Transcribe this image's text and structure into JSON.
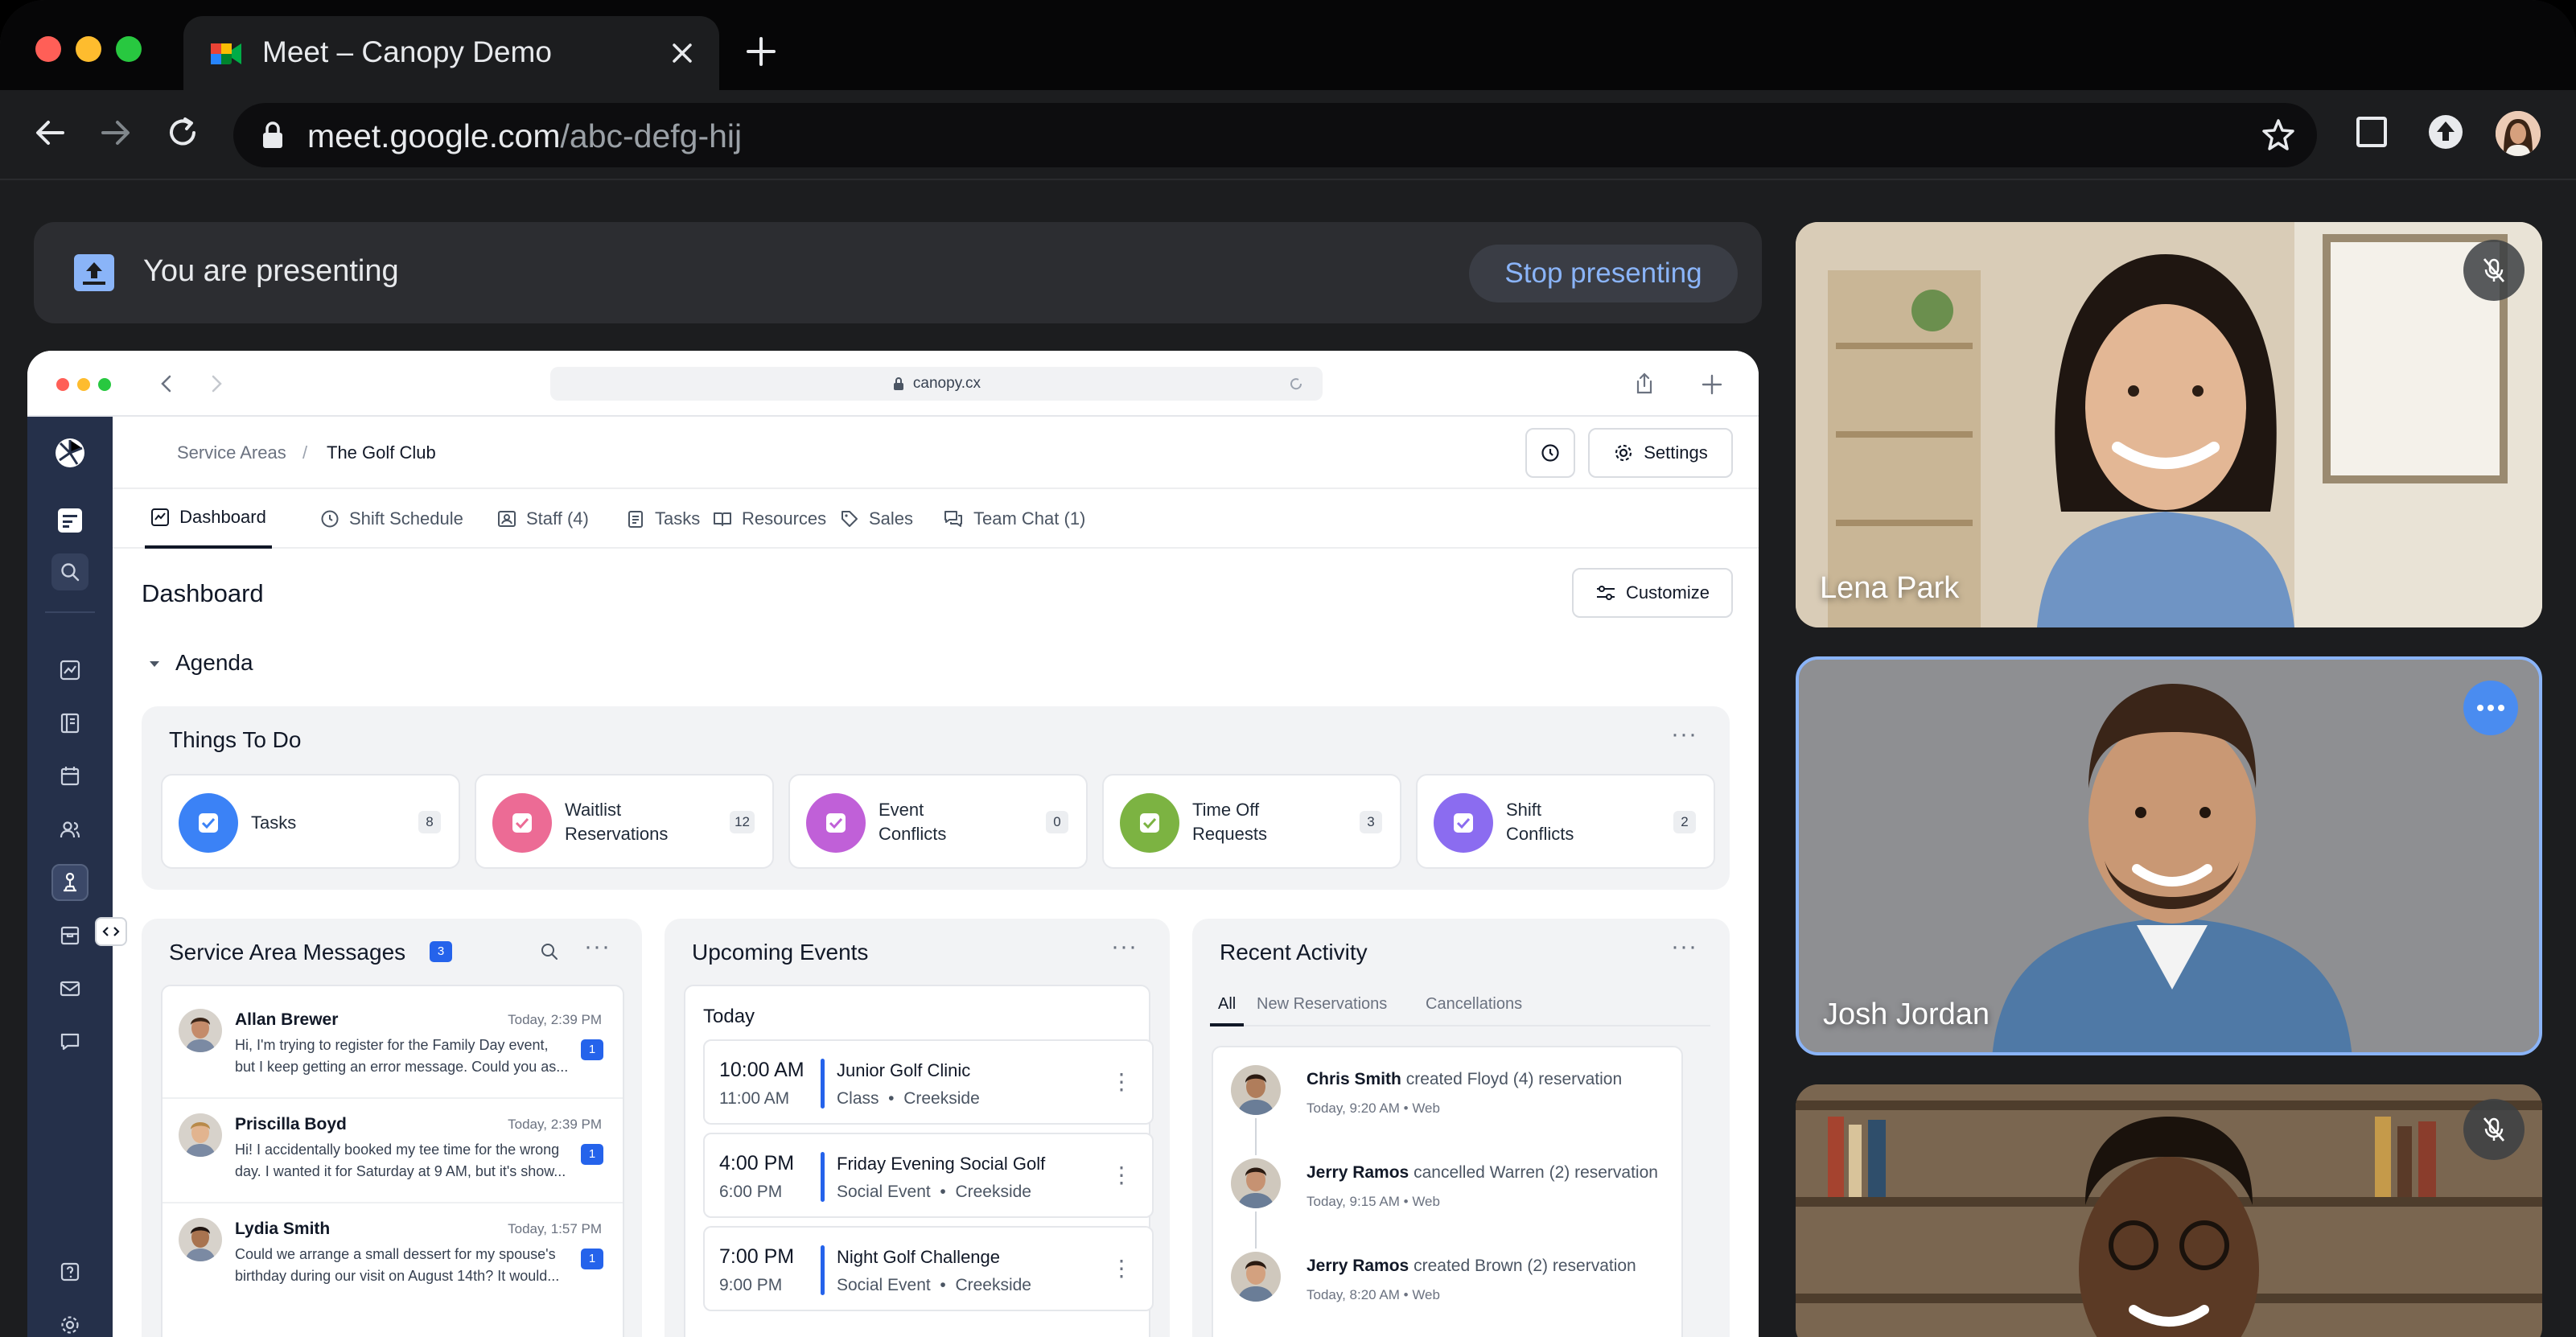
{
  "browser": {
    "tab_title": "Meet – Canopy Demo",
    "url_host": "meet.google.com",
    "url_path": "/abc-defg-hij"
  },
  "presenting": {
    "message": "You are presenting",
    "stop_label": "Stop presenting"
  },
  "shared": {
    "safari_url": "canopy.cx",
    "breadcrumb": {
      "parent": "Service Areas",
      "separator": "/",
      "current": "The Golf Club"
    },
    "settings_label": "Settings",
    "tabs": [
      {
        "label": "Dashboard"
      },
      {
        "label": "Shift Schedule"
      },
      {
        "label": "Staff (4)"
      },
      {
        "label": "Tasks"
      },
      {
        "label": "Resources"
      },
      {
        "label": "Sales"
      },
      {
        "label": "Team Chat (1)"
      }
    ],
    "page_title": "Dashboard",
    "customize_label": "Customize",
    "agenda_label": "Agenda",
    "things_to_do": {
      "title": "Things To Do",
      "items": [
        {
          "label1": "Tasks",
          "label2": "",
          "count": "8",
          "color": "#3b82f6"
        },
        {
          "label1": "Waitlist",
          "label2": "Reservations",
          "count": "12",
          "color": "#ec6b95"
        },
        {
          "label1": "Event",
          "label2": "Conflicts",
          "count": "0",
          "color": "#c060d8"
        },
        {
          "label1": "Time Off",
          "label2": "Requests",
          "count": "3",
          "color": "#7cb342"
        },
        {
          "label1": "Shift",
          "label2": "Conflicts",
          "count": "2",
          "color": "#8b6cf0"
        }
      ]
    },
    "messages": {
      "title": "Service Area Messages",
      "badge": "3",
      "items": [
        {
          "name": "Allan Brewer",
          "time": "Today, 2:39 PM",
          "line1": "Hi, I'm trying to register for the Family Day event,",
          "line2": "but I keep getting an error message. Could you as...",
          "badge": "1"
        },
        {
          "name": "Priscilla Boyd",
          "time": "Today, 2:39 PM",
          "line1": "Hi! I accidentally booked my tee time for the wrong",
          "line2": "day. I wanted it for Saturday at 9 AM, but it's show...",
          "badge": "1"
        },
        {
          "name": "Lydia Smith",
          "time": "Today, 1:57 PM",
          "line1": "Could we arrange a small dessert for my spouse's",
          "line2": "birthday during our visit on August 14th? It would...",
          "badge": "1"
        }
      ]
    },
    "events": {
      "title": "Upcoming Events",
      "day": "Today",
      "items": [
        {
          "start": "10:00 AM",
          "end": "11:00 AM",
          "name": "Junior Golf Clinic",
          "type": "Class",
          "place": "Creekside"
        },
        {
          "start": "4:00 PM",
          "end": "6:00 PM",
          "name": "Friday Evening Social Golf",
          "type": "Social Event",
          "place": "Creekside"
        },
        {
          "start": "7:00 PM",
          "end": "9:00 PM",
          "name": "Night Golf Challenge",
          "type": "Social Event",
          "place": "Creekside"
        }
      ]
    },
    "activity": {
      "title": "Recent Activity",
      "tabs": [
        "All",
        "New Reservations",
        "Cancellations"
      ],
      "items": [
        {
          "who": "Chris Smith",
          "verb": "created",
          "what": "Floyd (4) reservation",
          "when": "Today, 9:20 AM • Web"
        },
        {
          "who": "Jerry Ramos",
          "verb": "cancelled",
          "what": "Warren (2) reservation",
          "when": "Today, 9:15 AM • Web"
        },
        {
          "who": "Jerry Ramos",
          "verb": "created",
          "what": "Brown (2) reservation",
          "when": "Today, 8:20 AM • Web"
        }
      ]
    }
  },
  "participants": [
    {
      "name": "Lena Park",
      "muted": true
    },
    {
      "name": "Josh Jordan",
      "muted": false,
      "speaking": true
    },
    {
      "name": "",
      "muted": true
    }
  ]
}
